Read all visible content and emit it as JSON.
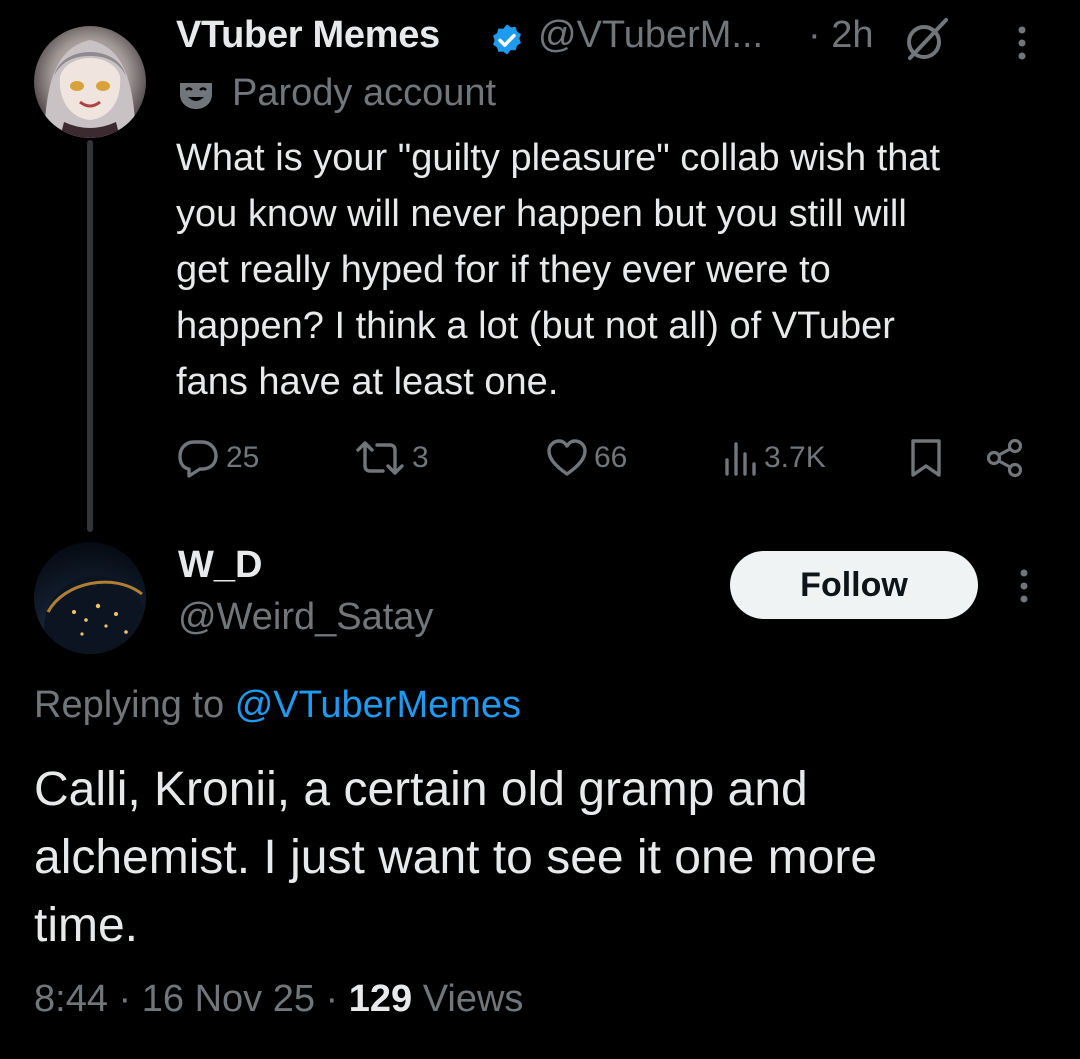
{
  "parent_tweet": {
    "author_name": "VTuber Memes",
    "author_handle": "@VTuberM...",
    "time": "· 2h",
    "verified": true,
    "label": "Parody account",
    "text": "What is your \"guilty pleasure\" collab wish that\nyou know will never happen but you still will\nget really hyped for if they ever were to\nhappen? I think a lot (but not all) of VTuber\nfans have at least one.",
    "actions": {
      "reply_count": "25",
      "retweet_count": "3",
      "like_count": "66",
      "view_count": "3.7K"
    }
  },
  "reply_tweet": {
    "author_name": "W_D",
    "author_handle": "@Weird_Satay",
    "follow_label": "Follow",
    "replying_prefix": "Replying to",
    "replying_to": "@VTuberMemes",
    "text": "Calli, Kronii, a certain old gramp and\nalchemist. I just want to see it one more\ntime.",
    "meta": {
      "time": "8:44",
      "sep1": "·",
      "date": "16 Nov 25",
      "sep2": "·",
      "views_count": "129",
      "views_label": "Views"
    }
  },
  "colors": {
    "background": "#000000",
    "primary_text": "#e7e9ea",
    "secondary_text": "#71767b",
    "link": "#1d9bf0",
    "verified_badge": "#1d9bf0",
    "follow_button_bg": "#eff3f4"
  },
  "icons": {
    "verified": "verified-badge-icon",
    "grok": "grok-icon",
    "more": "more-options-icon",
    "parody": "theater-mask-icon",
    "reply": "reply-icon",
    "retweet": "retweet-icon",
    "like": "heart-icon",
    "views": "views-icon",
    "bookmark": "bookmark-icon",
    "share": "share-icon"
  }
}
